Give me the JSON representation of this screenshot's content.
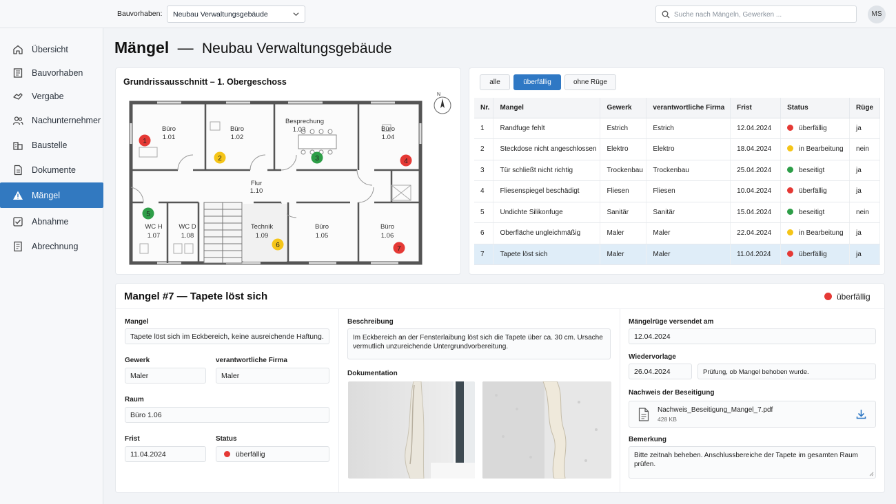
{
  "topbar": {
    "project_label": "Bauvorhaben:",
    "project_value": "Neubau Verwaltungsgebäude",
    "search_placeholder": "Suche nach Mängeln, Gewerken ...",
    "avatar_initials": "MS"
  },
  "sidebar": {
    "items": [
      {
        "label": "Übersicht",
        "icon": "home-icon"
      },
      {
        "label": "Bauvorhaben",
        "icon": "building-plan-icon"
      },
      {
        "label": "Vergabe",
        "icon": "handshake-icon"
      },
      {
        "label": "Nachunternehmer",
        "icon": "users-icon"
      },
      {
        "label": "Baustelle",
        "icon": "site-icon"
      },
      {
        "label": "Dokumente",
        "icon": "document-icon"
      },
      {
        "label": "Mängel",
        "icon": "warning-icon"
      },
      {
        "label": "Abnahme",
        "icon": "check-icon"
      },
      {
        "label": "Abrechnung",
        "icon": "invoice-icon"
      }
    ],
    "active_index": 6
  },
  "page": {
    "title": "Mängel",
    "separator": "—",
    "subtitle": "Neubau Verwaltungsgebäude"
  },
  "floorplan": {
    "title": "Grundrissausschnitt – 1. Obergeschoss",
    "rooms": [
      {
        "name": "Büro",
        "number": "1.01"
      },
      {
        "name": "Büro",
        "number": "1.02"
      },
      {
        "name": "Besprechung",
        "number": "1.03"
      },
      {
        "name": "Büro",
        "number": "1.04"
      },
      {
        "name": "Flur",
        "number": "1.10"
      },
      {
        "name": "WC H",
        "number": "1.07"
      },
      {
        "name": "WC D",
        "number": "1.08"
      },
      {
        "name": "Technik",
        "number": "1.09"
      },
      {
        "name": "Büro",
        "number": "1.05"
      },
      {
        "name": "Büro",
        "number": "1.06"
      }
    ],
    "compass_label": "N",
    "markers": [
      {
        "label": "1",
        "status": "überfällig"
      },
      {
        "label": "2",
        "status": "in Bearbeitung"
      },
      {
        "label": "3",
        "status": "beseitigt"
      },
      {
        "label": "4",
        "status": "überfällig"
      },
      {
        "label": "5",
        "status": "beseitigt"
      },
      {
        "label": "6",
        "status": "in Bearbeitung"
      },
      {
        "label": "7",
        "status": "überfällig"
      }
    ]
  },
  "filters": [
    "alle",
    "überfällig",
    "ohne Rüge"
  ],
  "active_filter": 1,
  "table": {
    "headers": [
      "Nr.",
      "Mangel",
      "Gewerk",
      "verantwortliche Firma",
      "Frist",
      "Status",
      "Rüge"
    ],
    "rows": [
      [
        "1",
        "Randfuge fehlt",
        "Estrich",
        "Estrich",
        "12.04.2024",
        "überfällig",
        "ja"
      ],
      [
        "2",
        "Steckdose nicht angeschlossen",
        "Elektro",
        "Elektro",
        "18.04.2024",
        "in Bearbeitung",
        "nein"
      ],
      [
        "3",
        "Tür schließt nicht richtig",
        "Trockenbau",
        "Trockenbau",
        "25.04.2024",
        "beseitigt",
        "ja"
      ],
      [
        "4",
        "Fliesenspiegel beschädigt",
        "Fliesen",
        "Fliesen",
        "10.04.2024",
        "überfällig",
        "ja"
      ],
      [
        "5",
        "Undichte Silikonfuge",
        "Sanitär",
        "Sanitär",
        "15.04.2024",
        "beseitigt",
        "nein"
      ],
      [
        "6",
        "Oberfläche ungleichmäßig",
        "Maler",
        "Maler",
        "22.04.2024",
        "in Bearbeitung",
        "ja"
      ],
      [
        "7",
        "Tapete löst sich",
        "Maler",
        "Maler",
        "11.04.2024",
        "überfällig",
        "ja"
      ]
    ],
    "selected_index": 6
  },
  "status_colors": {
    "überfällig": "#e53935",
    "in Bearbeitung": "#f5c518",
    "beseitigt": "#2e9e48"
  },
  "detail": {
    "title": "Mangel #7 — Tapete löst sich",
    "status": "überfällig",
    "mangel_label": "Mangel",
    "mangel_value": "Tapete löst sich im Eckbereich, keine ausreichende Haftung.",
    "gewerk_label": "Gewerk",
    "gewerk_value": "Maler",
    "firma_label": "verantwortliche Firma",
    "firma_value": "Maler",
    "raum_label": "Raum",
    "raum_value": "Büro 1.06",
    "frist_label": "Frist",
    "frist_value": "11.04.2024",
    "status_label": "Status",
    "status_value": "überfällig",
    "beschreibung_label": "Beschreibung",
    "beschreibung_value": "Im Eckbereich an der Fensterlaibung löst sich die Tapete über ca. 30 cm. Ursache vermutlich unzureichende Untergrundvorbereitung.",
    "dokumentation_label": "Dokumentation",
    "ruege_label": "Mängelrüge versendet am",
    "ruege_value": "12.04.2024",
    "wiedervorlage_label": "Wiedervorlage",
    "wiedervorlage_date": "26.04.2024",
    "wiedervorlage_note": "Prüfung, ob Mangel behoben wurde.",
    "nachweis_label": "Nachweis der Beseitigung",
    "nachweis_file": "Nachweis_Beseitigung_Mangel_7.pdf",
    "nachweis_size": "428 KB",
    "bemerkung_label": "Bemerkung",
    "bemerkung_value": "Bitte zeitnah beheben. Anschlussbereiche der Tapete im gesamten Raum prüfen."
  }
}
